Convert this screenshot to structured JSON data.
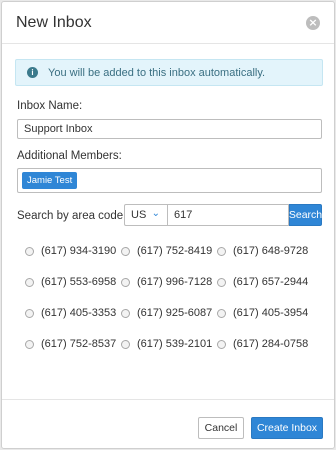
{
  "modal": {
    "title": "New Inbox",
    "close_icon": "close-icon"
  },
  "alert": {
    "icon": "info-icon",
    "text": "You will be added to this inbox automatically."
  },
  "inbox_name": {
    "label": "Inbox Name:",
    "value": "Support Inbox"
  },
  "members": {
    "label": "Additional Members:",
    "chips": [
      "Jamie Test"
    ]
  },
  "area_search": {
    "label": "Search by area code:",
    "country": "US",
    "area_code": "617",
    "button": "Search"
  },
  "numbers": [
    "(617) 934-3190",
    "(617) 752-8419",
    "(617) 648-9728",
    "(617) 553-6958",
    "(617) 996-7128",
    "(617) 657-2944",
    "(617) 405-3353",
    "(617) 925-6087",
    "(617) 405-3954",
    "(617) 752-8537",
    "(617) 539-2101",
    "(617) 284-0758"
  ],
  "footer": {
    "cancel": "Cancel",
    "create": "Create Inbox"
  },
  "colors": {
    "primary": "#2f86d6",
    "alert_bg": "#e3f4fb"
  }
}
